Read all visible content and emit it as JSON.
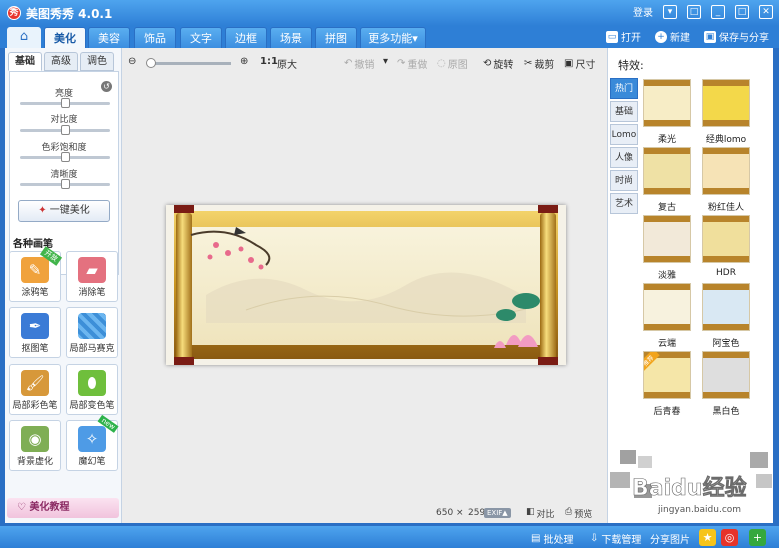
{
  "app": {
    "logo": "秀",
    "title": "美图秀秀 4.0.1",
    "login": "登录"
  },
  "window_buttons": [
    "▾",
    "□",
    "_",
    "□",
    "✕"
  ],
  "tabs": [
    "美化",
    "美容",
    "饰品",
    "文字",
    "边框",
    "场景",
    "拼图",
    "更多功能▾"
  ],
  "tab_actions": {
    "open": "打开",
    "new": "新建",
    "save_share": "保存与分享"
  },
  "left": {
    "subtabs": [
      "基础",
      "高级",
      "调色"
    ],
    "sliders": [
      {
        "label": "亮度",
        "value": 0.5
      },
      {
        "label": "对比度",
        "value": 0.5
      },
      {
        "label": "色彩饱和度",
        "value": 0.5
      },
      {
        "label": "清晰度",
        "value": 0.5
      }
    ],
    "one_click": "一键美化",
    "brush_section": "各种画笔",
    "brushes": [
      {
        "label": "涂鸦笔",
        "badge": "开放"
      },
      {
        "label": "消除笔",
        "badge": ""
      },
      {
        "label": "抠图笔",
        "badge": ""
      },
      {
        "label": "局部马赛克",
        "badge": ""
      },
      {
        "label": "局部彩色笔",
        "badge": ""
      },
      {
        "label": "局部变色笔",
        "badge": ""
      },
      {
        "label": "背景虚化",
        "badge": ""
      },
      {
        "label": "魔幻笔",
        "badge": "new"
      }
    ],
    "tutorial": "美化教程"
  },
  "toolbar": {
    "zoom_ratio": "1:1",
    "original_size": "原大",
    "undo": "撤销",
    "redo": "重做",
    "original": "原图",
    "rotate": "旋转",
    "crop": "裁剪",
    "size": "尺寸"
  },
  "canvas": {
    "width_px": "650",
    "times": "×",
    "height_px": "259",
    "exif": "EXIF▲",
    "compare": "对比",
    "preview": "预览"
  },
  "right": {
    "title": "特效:",
    "categories": [
      "热门",
      "基础",
      "Lomo",
      "人像",
      "时尚",
      "艺术"
    ],
    "effects": [
      {
        "label": "柔光",
        "tint": "#f7edc6",
        "badge": ""
      },
      {
        "label": "经典lomo",
        "tint": "#f3d84a",
        "badge": ""
      },
      {
        "label": "复古",
        "tint": "#efe1a5",
        "badge": ""
      },
      {
        "label": "粉红佳人",
        "tint": "#f6e3b6",
        "badge": ""
      },
      {
        "label": "淡雅",
        "tint": "#f2e9d9",
        "badge": ""
      },
      {
        "label": "HDR",
        "tint": "#f0df9c",
        "badge": ""
      },
      {
        "label": "云端",
        "tint": "#f7f2de",
        "badge": ""
      },
      {
        "label": "阿宝色",
        "tint": "#d9e8f3",
        "badge": ""
      },
      {
        "label": "后青春",
        "tint": "#f5e6a8",
        "badge": "推荐"
      },
      {
        "label": "黑白色",
        "tint": "#dedede",
        "badge": ""
      }
    ]
  },
  "bottom": {
    "batch": "批处理",
    "download": "下载管理",
    "share": "分享图片"
  },
  "watermark": {
    "text": "Baidu经验",
    "url": "jingyan.baidu.com"
  }
}
